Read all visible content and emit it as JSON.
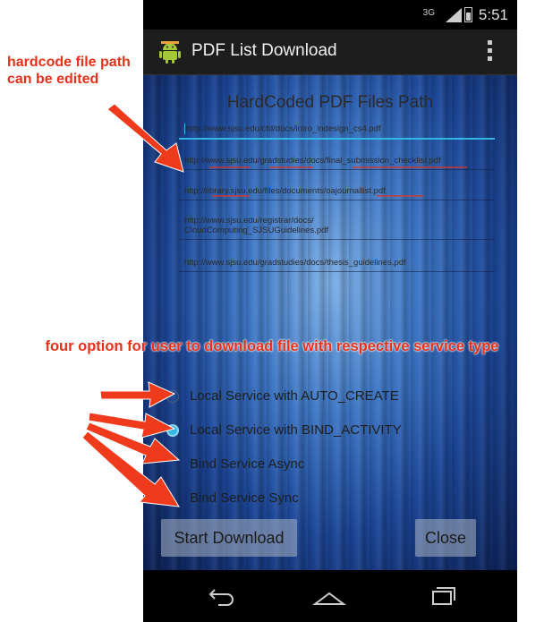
{
  "annotations": {
    "top": "hardcode file path\ncan be edited",
    "middle": "four option for user to download file with respective service type"
  },
  "status_bar": {
    "signal": "3G",
    "time": "5:51"
  },
  "action_bar": {
    "title": "PDF List Download",
    "app_icon": "android-icon",
    "overflow_icon": "overflow-menu-icon"
  },
  "content": {
    "heading": "HardCoded PDF Files Path",
    "paths": [
      "http://www.sjsu.edu/cfd/docs/intro_indesign_cs4.pdf",
      "http://www.sjsu.edu/gradstudies/docs/final_submission_checklist.pdf",
      "http://library.sjsu.edu/files/documents/oajournallist.pdf",
      "http://www.sjsu.edu/registrar/docs/\nCloudComputing_SJSUGuidelines.pdf",
      "http://www.sjsu.edu/gradstudies/docs/thesis_guidelines.pdf"
    ],
    "options": [
      {
        "label": "Local Service with AUTO_CREATE",
        "checked": false
      },
      {
        "label": "Local Service with BIND_ACTIVITY",
        "checked": true
      },
      {
        "label": "Bind Service Async",
        "checked": false
      },
      {
        "label": "Bind Service Sync",
        "checked": false
      }
    ],
    "start_button": "Start Download",
    "close_button": "Close"
  },
  "nav_bar": {
    "icons": [
      "back-icon",
      "home-icon",
      "recent-apps-icon"
    ]
  },
  "colors": {
    "annotation": "#e8311a",
    "accent": "#33b5e5",
    "background_blue": "#2a5db0"
  }
}
